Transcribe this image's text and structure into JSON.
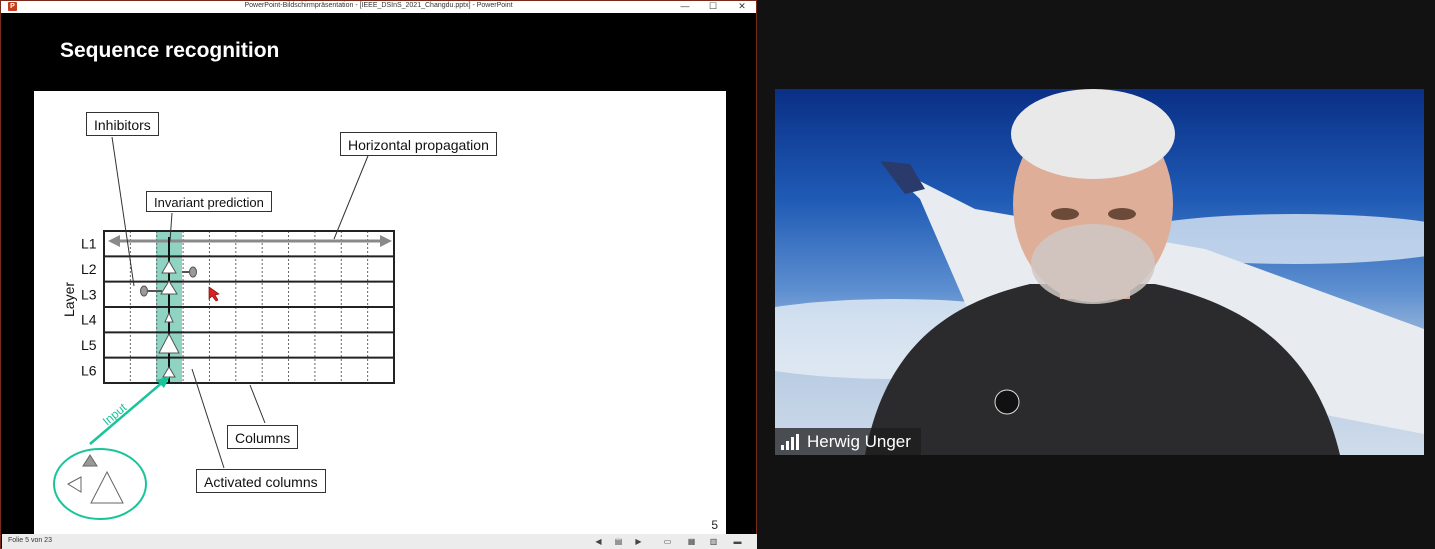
{
  "window": {
    "title": "PowerPoint-Bildschirmpräsentation - [IEEE_DSInS_2021_Changdu.pptx] - PowerPoint",
    "app_icon": "P",
    "minimize_glyph": "—",
    "maximize_glyph": "☐",
    "close_glyph": "✕"
  },
  "slide": {
    "title": "Sequence recognition",
    "number": "5",
    "layer_axis_label": "Layer",
    "layers": [
      "L1",
      "L2",
      "L3",
      "L4",
      "L5",
      "L6"
    ],
    "callouts": {
      "inhibitors": "Inhibitors",
      "horizontal_propagation": "Horizontal propagation",
      "invariant_prediction": "Invariant prediction",
      "columns": "Columns",
      "activated_columns": "Activated columns"
    },
    "input_label": "Input",
    "colors": {
      "activated_column": "#8fd3c2",
      "input_arrow": "#19c49a",
      "grid_line": "#222222",
      "gray_marker": "#9a9a9a"
    }
  },
  "status_bar": {
    "slide_counter": "Folie 5 von 23",
    "icons": [
      "prev-slide-icon",
      "notes-icon",
      "next-slide-icon",
      "normal-view-icon",
      "slide-sorter-icon",
      "reading-view-icon",
      "presenter-view-icon"
    ]
  },
  "video": {
    "participant_name": "Herwig Unger",
    "icon": "signal-strength-icon"
  }
}
